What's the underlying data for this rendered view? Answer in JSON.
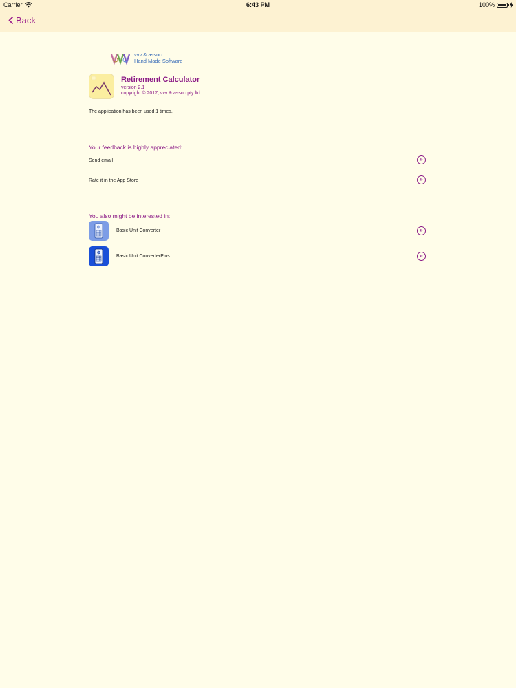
{
  "status_bar": {
    "carrier": "Carrier",
    "time": "6:43 PM",
    "battery": "100%",
    "icons": [
      "wifi-icon",
      "battery-icon",
      "charging-icon"
    ]
  },
  "nav": {
    "back_label": "Back",
    "accent_color": "#9b1e8c"
  },
  "company": {
    "name": "vvv & assoc",
    "tagline": "Hand Made Software"
  },
  "app": {
    "title": "Retirement Calculator",
    "version": "version 2.1",
    "copyright": "copyright © 2017, vvv & assoc pty ltd."
  },
  "usage": {
    "text": "The application has been used 1 times."
  },
  "feedback": {
    "title": "Your feedback is highly appreciated:",
    "items": [
      {
        "label": "Send email",
        "icon": "double-chevron-right-icon"
      },
      {
        "label": "Rate it in the App Store",
        "icon": "double-chevron-right-icon"
      }
    ]
  },
  "related": {
    "title": "You also might be interested in:",
    "items": [
      {
        "label": "Basic Unit Converter",
        "icon": "calculator-app-icon",
        "color": "#7d9de6"
      },
      {
        "label": "Basic Unit ConverterPlus",
        "icon": "calculator-app-icon",
        "color": "#1a4fd8"
      }
    ]
  },
  "chevron_glyph": "»"
}
